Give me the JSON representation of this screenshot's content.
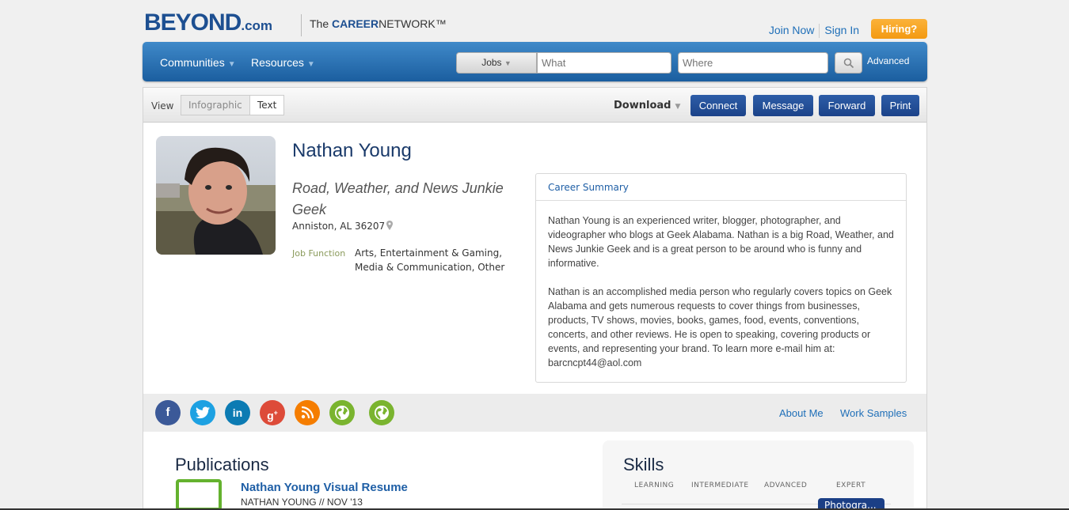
{
  "header": {
    "logo_text": "BEYOND",
    "logo_suffix": ".com",
    "tagline_prefix": "The ",
    "tagline_bold": "CAREER",
    "tagline_rest": "NETWORK™",
    "join_now": "Join Now",
    "sign_in": "Sign In",
    "hiring": "Hiring?"
  },
  "nav": {
    "communities": "Communities",
    "resources": "Resources",
    "jobs_select": "Jobs",
    "what_placeholder": "What",
    "where_placeholder": "Where",
    "advanced": "Advanced"
  },
  "toolbar": {
    "view_label": "View",
    "view_options": [
      "Infographic",
      "Text"
    ],
    "download": "Download",
    "connect": "Connect",
    "message": "Message",
    "forward": "Forward",
    "print": "Print"
  },
  "profile": {
    "name": "Nathan Young",
    "headline": "Road, Weather, and News Junkie Geek",
    "location": "Anniston, AL 36207",
    "job_function_label": "Job Function",
    "job_function_value": "Arts, Entertainment & Gaming, Media & Communication, Other"
  },
  "career_summary": {
    "title": "Career Summary",
    "paragraph1": "Nathan Young is an experienced writer, blogger, photographer, and videographer who blogs at Geek Alabama. Nathan is a big Road, Weather, and News Junkie Geek and is a great person to be around who is funny and informative.",
    "paragraph2": "Nathan is an accomplished media person who regularly covers topics on Geek Alabama and gets numerous requests to cover things from businesses, products, TV shows, movies, books, games, food, events, conventions, concerts, and other reviews. He is open to speaking, covering products or events, and representing your brand. To learn more e-mail him at: barcncpt44@aol.com"
  },
  "social": {
    "icons": [
      "facebook-icon",
      "twitter-icon",
      "linkedin-icon",
      "google-plus-icon",
      "blog-icon",
      "website-icon",
      "website-icon"
    ],
    "about_me": "About Me",
    "work_samples": "Work Samples"
  },
  "publications": {
    "title": "Publications",
    "item_title": "Nathan Young Visual Resume",
    "item_meta": "NATHAN YOUNG // NOV '13"
  },
  "skills": {
    "title": "Skills",
    "columns": [
      "LEARNING",
      "INTERMEDIATE",
      "ADVANCED",
      "EXPERT"
    ],
    "expert_skill": "Photogra..."
  },
  "colors": {
    "brand_blue": "#1d4f91",
    "nav_blue": "#2a6fb4",
    "hiring_orange": "#f5a623",
    "link_blue": "#1f6fb8"
  }
}
